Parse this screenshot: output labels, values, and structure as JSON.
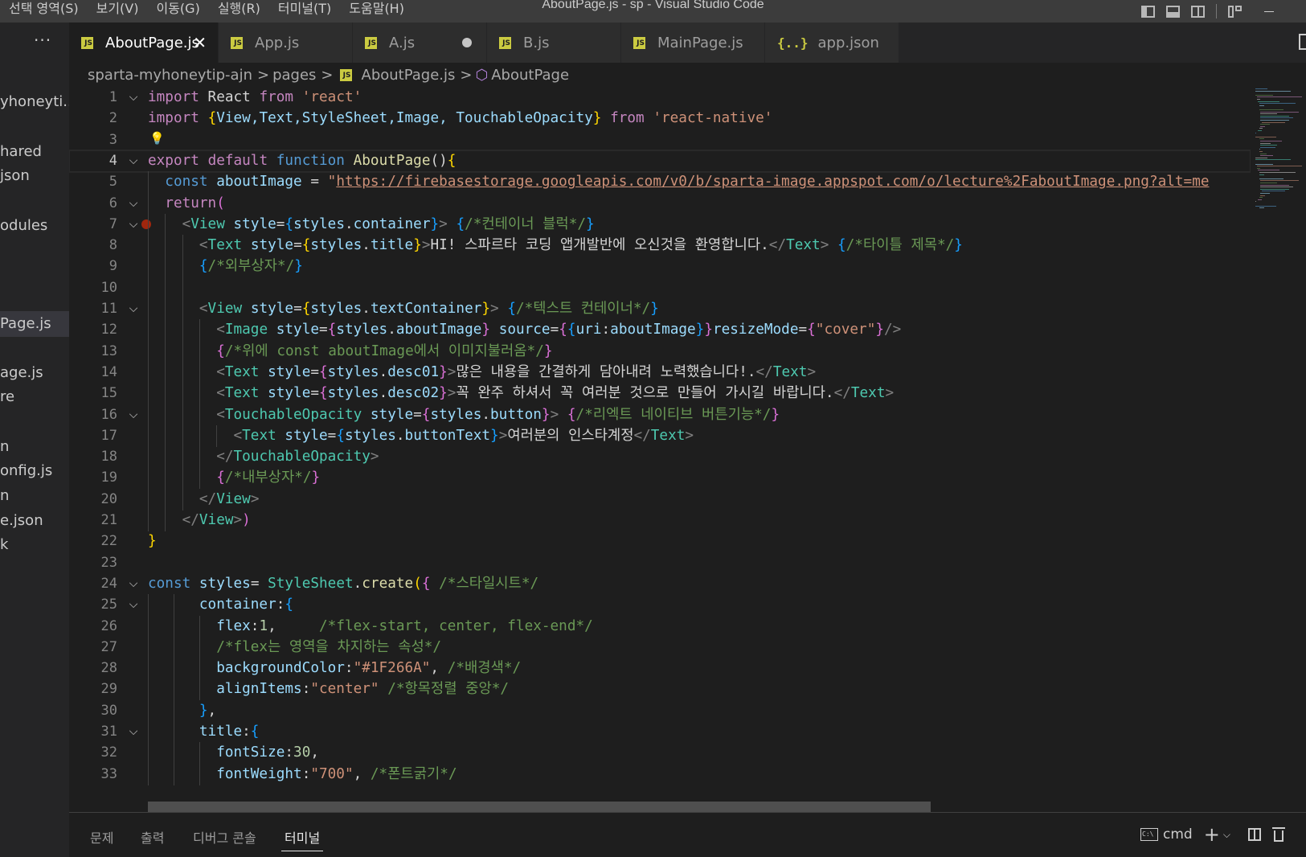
{
  "titlebar": {
    "menus": [
      "선택 영역(S)",
      "보기(V)",
      "이동(G)",
      "실행(R)",
      "터미널(T)",
      "도움말(H)"
    ],
    "title": "AboutPage.js - sp - Visual Studio Code"
  },
  "explorer": {
    "more": "···",
    "items": [
      "yhoneyti...",
      "hared",
      "json",
      "odules",
      "Page.js",
      "age.js",
      "re",
      "n",
      "onfig.js",
      "n",
      "e.json",
      "k"
    ],
    "active_index": 4
  },
  "tabs": [
    {
      "label": "AboutPage.js",
      "icon": "js-icon",
      "close": "✕"
    },
    {
      "label": "App.js",
      "icon": "js-icon"
    },
    {
      "label": "A.js",
      "icon": "js-icon",
      "modified": true
    },
    {
      "label": "B.js",
      "icon": "js-icon"
    },
    {
      "label": "MainPage.js",
      "icon": "js-icon"
    },
    {
      "label": "app.json",
      "icon": "json-icon",
      "glyph": "{..}"
    }
  ],
  "breadcrumb": {
    "parts": [
      "sparta-myhoneytip-ajn",
      "pages",
      "AboutPage.js",
      "AboutPage"
    ],
    "chevron": ">",
    "js_badge": "JS",
    "symbol_glyph": "⬡"
  },
  "editor": {
    "current_line": 4,
    "fold_glyph": "⌵",
    "bulb_glyph": "💡",
    "lines": [
      {
        "n": "1",
        "fold": true
      },
      {
        "n": "2",
        "fold": false
      },
      {
        "n": "3",
        "fold": false
      },
      {
        "n": "4",
        "fold": true
      },
      {
        "n": "5",
        "fold": false
      },
      {
        "n": "6",
        "fold": true
      },
      {
        "n": "7",
        "fold": true
      },
      {
        "n": "8",
        "fold": false
      },
      {
        "n": "9",
        "fold": false
      },
      {
        "n": "10",
        "fold": false
      },
      {
        "n": "11",
        "fold": true
      },
      {
        "n": "12",
        "fold": false
      },
      {
        "n": "13",
        "fold": false
      },
      {
        "n": "14",
        "fold": false
      },
      {
        "n": "15",
        "fold": false
      },
      {
        "n": "16",
        "fold": true
      },
      {
        "n": "17",
        "fold": false
      },
      {
        "n": "18",
        "fold": false
      },
      {
        "n": "19",
        "fold": false
      },
      {
        "n": "20",
        "fold": false
      },
      {
        "n": "21",
        "fold": false
      },
      {
        "n": "22",
        "fold": false
      },
      {
        "n": "23",
        "fold": false
      },
      {
        "n": "24",
        "fold": true
      },
      {
        "n": "25",
        "fold": true
      },
      {
        "n": "26",
        "fold": false
      },
      {
        "n": "27",
        "fold": false
      },
      {
        "n": "28",
        "fold": false
      },
      {
        "n": "29",
        "fold": false
      },
      {
        "n": "30",
        "fold": false
      },
      {
        "n": "31",
        "fold": true
      },
      {
        "n": "32",
        "fold": false
      },
      {
        "n": "33",
        "fold": false
      }
    ],
    "tokens": {
      "l1": [
        "import",
        " React ",
        "from",
        " ",
        "'react'"
      ],
      "l2": [
        "import",
        " ",
        "{",
        "View,Text,StyleSheet,Image, TouchableOpacity",
        "}",
        " ",
        "from",
        " ",
        "'react-native'"
      ],
      "l4": [
        "export",
        " ",
        "default",
        " ",
        "function",
        " ",
        "AboutPage",
        "()",
        "{"
      ],
      "l5": [
        "const",
        " ",
        "aboutImage",
        " = ",
        "\"",
        "https://firebasestorage.googleapis.com/v0/b/sparta-image.appspot.com/o/lecture%2FaboutImage.png?alt=me"
      ],
      "l6": [
        "return",
        "("
      ],
      "l7": [
        "<",
        "View",
        " ",
        "style",
        "=",
        "{",
        "styles",
        ".",
        "container",
        "}",
        ">",
        " ",
        "{",
        "/*컨테이너 블럭*/",
        "}"
      ],
      "l8": [
        "<",
        "Text",
        " ",
        "style",
        "=",
        "{",
        "styles",
        ".",
        "title",
        "}",
        ">",
        "HI! 스파르타 코딩 앱개발반에 오신것을 환영합니다.",
        "</",
        "Text",
        ">",
        " ",
        "{",
        "/*타이틀 제목*/",
        "}"
      ],
      "l9": [
        "{",
        "/*외부상자*/",
        "}"
      ],
      "l11": [
        "<",
        "View",
        " ",
        "style",
        "=",
        "{",
        "styles",
        ".",
        "textContainer",
        "}",
        ">",
        " ",
        "{",
        "/*텍스트 컨테이너*/",
        "}"
      ],
      "l12": [
        "<",
        "Image",
        " ",
        "style",
        "=",
        "{",
        "styles",
        ".",
        "aboutImage",
        "}",
        " ",
        "source",
        "=",
        "{",
        "{",
        "uri",
        ":",
        "aboutImage",
        "}",
        "}",
        "resizeMode",
        "=",
        "{",
        "\"cover\"",
        "}",
        "/>"
      ],
      "l13": [
        "{",
        "/*위에 const aboutImage에서 이미지불러옴*/",
        "}"
      ],
      "l14": [
        "<",
        "Text",
        " ",
        "style",
        "=",
        "{",
        "styles",
        ".",
        "desc01",
        "}",
        ">",
        "많은 내용을 간결하게 담아내려 노력했습니다!.",
        "</",
        "Text",
        ">"
      ],
      "l15": [
        "<",
        "Text",
        " ",
        "style",
        "=",
        "{",
        "styles",
        ".",
        "desc02",
        "}",
        ">",
        "꼭 완주 하셔서 꼭 여러분 것으로 만들어 가시길 바랍니다.",
        "</",
        "Text",
        ">"
      ],
      "l16": [
        "<",
        "TouchableOpacity",
        " ",
        "style",
        "=",
        "{",
        "styles",
        ".",
        "button",
        "}",
        ">",
        " ",
        "{",
        "/*리엑트 네이티브 버튼기능*/",
        "}"
      ],
      "l17": [
        "<",
        "Text",
        " ",
        "style",
        "=",
        "{",
        "styles",
        ".",
        "buttonText",
        "}",
        ">",
        "여러분의 인스타계정",
        "</",
        "Text",
        ">"
      ],
      "l18": [
        "</",
        "TouchableOpacity",
        ">"
      ],
      "l19": [
        "{",
        "/*내부상자*/",
        "}"
      ],
      "l20": [
        "</",
        "View",
        ">"
      ],
      "l21": [
        "</",
        "View",
        ">",
        ")"
      ],
      "l22": [
        "}"
      ],
      "l24": [
        "const",
        " ",
        "styles",
        "= ",
        "StyleSheet",
        ".",
        "create",
        "(",
        "{",
        " ",
        "/*스타일시트*/"
      ],
      "l25": [
        "container",
        ":",
        "{"
      ],
      "l26": [
        "flex",
        ":",
        "1",
        ",     ",
        "/*flex-start, center, flex-end*/"
      ],
      "l27": [
        "/*flex는 영역을 차지하는 속성*/"
      ],
      "l28": [
        "backgroundColor",
        ":",
        "\"#1F266A\"",
        ", ",
        "/*배경색*/"
      ],
      "l29": [
        "alignItems",
        ":",
        "\"center\"",
        " ",
        "/*항목정렬 중앙*/"
      ],
      "l30": [
        "}",
        ","
      ],
      "l31": [
        "title",
        ":",
        "{"
      ],
      "l32": [
        "fontSize",
        ":",
        "30",
        ","
      ],
      "l33": [
        "fontWeight",
        ":",
        "\"700\"",
        ", ",
        "/*폰트굵기*/"
      ]
    }
  },
  "panel": {
    "tabs": [
      "문제",
      "출력",
      "디버그 콘솔",
      "터미널"
    ],
    "active": "터미널",
    "terminal_icon_text": "C:\\",
    "shell": "cmd",
    "add_glyph": "+",
    "dropdown_glyph": "⌵",
    "trash_glyph": "🗑"
  },
  "colors": {
    "keyword_blue": "#569cd6",
    "keyword_purple": "#c586c0",
    "variable": "#9cdcfe",
    "string": "#ce9178",
    "comment": "#6a9955",
    "function": "#dcdcaa",
    "type": "#4ec9b0",
    "bracket_gold": "#ffd700",
    "bracket_purple": "#da70d6",
    "bracket_blue": "#179fff",
    "js_badge": "#cbcb41",
    "breakpoint": "#a1260d"
  }
}
